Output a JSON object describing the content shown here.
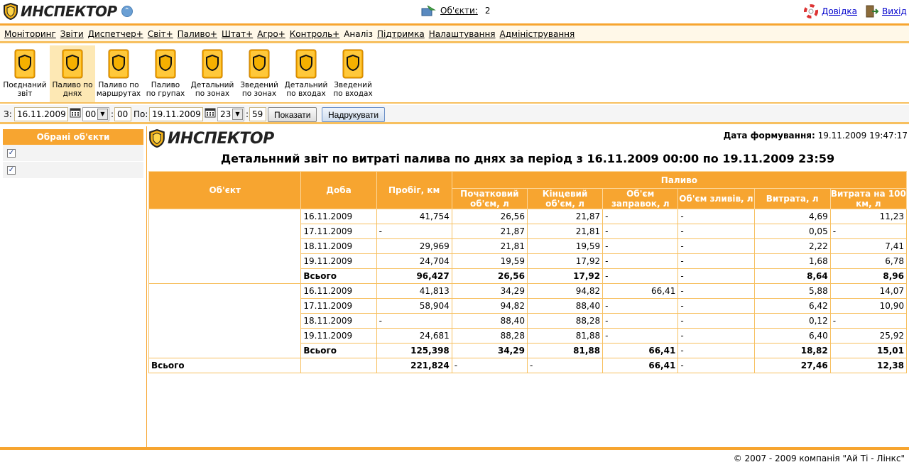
{
  "header": {
    "logo_text": "ИНСПЕКТОР",
    "objects_label": "Об'єкти:",
    "objects_count": "2",
    "help_label": "Довідка",
    "exit_label": "Вихід"
  },
  "menu": {
    "items": [
      "Моніторинг",
      "Звіти",
      "Диспетчер+",
      "Світ+",
      "Паливо+",
      "Штат+",
      "Агро+",
      "Контроль+",
      "Аналіз",
      "Підтримка",
      "Налаштування",
      "Адміністрування"
    ],
    "active": "Аналіз"
  },
  "toolbar": {
    "items": [
      {
        "l1": "Поєднаний",
        "l2": "звіт"
      },
      {
        "l1": "Паливо по",
        "l2": "днях"
      },
      {
        "l1": "Паливо по",
        "l2": "маршрутах"
      },
      {
        "l1": "Паливо",
        "l2": "по групах"
      },
      {
        "l1": "Детальний",
        "l2": "по зонах"
      },
      {
        "l1": "Зведений",
        "l2": "по зонах"
      },
      {
        "l1": "Детальний",
        "l2": "по входах"
      },
      {
        "l1": "Зведений",
        "l2": "по входах"
      }
    ]
  },
  "datebar": {
    "from_label": "З:",
    "from_date": "16.11.2009",
    "from_hour": "00",
    "from_min": "00",
    "to_label": "По:",
    "to_date": "19.11.2009",
    "to_hour": "23",
    "to_min": "59",
    "show_button": "Показати",
    "print_button": "Надрукувати"
  },
  "sidebar": {
    "title": "Обрані об'єкти"
  },
  "report": {
    "logo_text": "ИНСПЕКТОР",
    "date_label": "Дата формування:",
    "date_value": "19.11.2009 19:47:17",
    "title": "Детальнний звіт по витраті палива по днях за період з 16.11.2009 00:00 по 19.11.2009 23:59",
    "headers": {
      "object": "Об'єкт",
      "day": "Доба",
      "mileage": "Пробіг, км",
      "fuel": "Паливо",
      "start_vol": "Початковий об'єм, л",
      "end_vol": "Кінцевий об'єм, л",
      "refuel": "Об'єм заправок, л",
      "drain": "Об'єм зливів, л",
      "consumption": "Витрата, л",
      "per100": "Витрата на 100 км, л"
    },
    "groups": [
      {
        "rows": [
          [
            "16.11.2009",
            "41,754",
            "26,56",
            "21,87",
            "-",
            "-",
            "4,69",
            "11,23"
          ],
          [
            "17.11.2009",
            "-",
            "21,87",
            "21,81",
            "-",
            "-",
            "0,05",
            "-"
          ],
          [
            "18.11.2009",
            "29,969",
            "21,81",
            "19,59",
            "-",
            "-",
            "2,22",
            "7,41"
          ],
          [
            "19.11.2009",
            "24,704",
            "19,59",
            "17,92",
            "-",
            "-",
            "1,68",
            "6,78"
          ]
        ],
        "total": [
          "Всього",
          "96,427",
          "26,56",
          "17,92",
          "-",
          "-",
          "8,64",
          "8,96"
        ]
      },
      {
        "rows": [
          [
            "16.11.2009",
            "41,813",
            "34,29",
            "94,82",
            "66,41",
            "-",
            "5,88",
            "14,07"
          ],
          [
            "17.11.2009",
            "58,904",
            "94,82",
            "88,40",
            "-",
            "-",
            "6,42",
            "10,90"
          ],
          [
            "18.11.2009",
            "-",
            "88,40",
            "88,28",
            "-",
            "-",
            "0,12",
            "-"
          ],
          [
            "19.11.2009",
            "24,681",
            "88,28",
            "81,88",
            "-",
            "-",
            "6,40",
            "25,92"
          ]
        ],
        "total": [
          "Всього",
          "125,398",
          "34,29",
          "81,88",
          "66,41",
          "-",
          "18,82",
          "15,01"
        ]
      }
    ],
    "grand_total": [
      "Всього",
      "221,824",
      "-",
      "-",
      "66,41",
      "-",
      "27,46",
      "12,38"
    ]
  },
  "footer": {
    "copyright": "© 2007 - 2009 компанія \"Ай Ті - Лінкс\""
  }
}
